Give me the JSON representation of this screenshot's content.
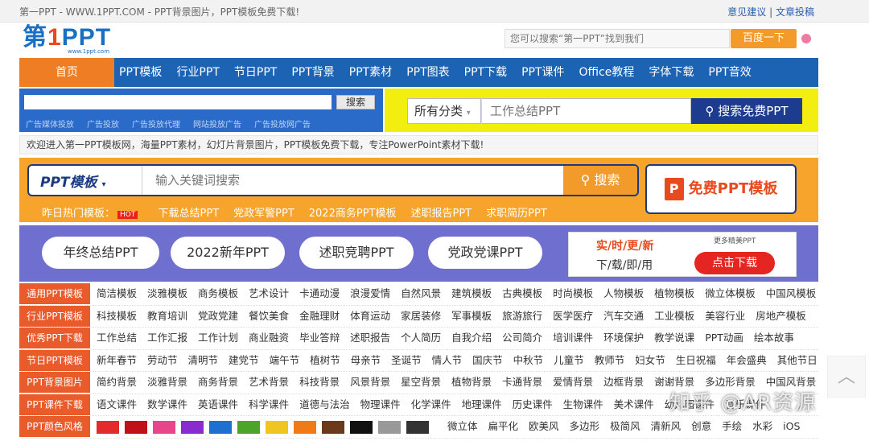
{
  "topbar": {
    "site": "第一PPT - WWW.1PPT.COM - PPT背景图片，PPT模板免费下载!",
    "feedback": "意见建议",
    "sep": " | ",
    "submit": "文章投稿"
  },
  "logo": {
    "text1": "第",
    "text2": "1",
    "text3": "PPT",
    "url": "www.1ppt.com"
  },
  "header_search": {
    "placeholder": "您可以搜索“第一PPT”找到我们",
    "button": "百度一下"
  },
  "nav": {
    "home": "首页",
    "items": [
      "PPT模板",
      "行业PPT",
      "节日PPT",
      "PPT背景",
      "PPT素材",
      "PPT图表",
      "PPT下载",
      "PPT课件",
      "Office教程",
      "字体下载",
      "PPT音效"
    ]
  },
  "ad": {
    "search_button": "搜索",
    "links": [
      "广告媒体投放",
      "广告投放",
      "广告投放代理",
      "网站投放广告",
      "广告投放网广告"
    ],
    "category": "所有分类",
    "keyword_placeholder": "工作总结PPT",
    "free_search": "搜索免费PPT"
  },
  "welcome": "欢迎进入第一PPT模板网，海量PPT素材，幻灯片背景图片，PPT模板免费下载，专注PowerPoint素材下载!",
  "orange": {
    "category": "PPT模板",
    "placeholder": "输入关键词搜索",
    "search": "搜索",
    "free": "免费PPT模板",
    "hot_label": "昨日热门模板：",
    "hot_badge": "HOT",
    "hot_items": [
      "下载总结PPT",
      "党政军警PPT",
      "2022商务PPT模板",
      "述职报告PPT",
      "求职简历PPT"
    ]
  },
  "purple": {
    "pills": [
      "年终总结PPT",
      "2022新年PPT",
      "述职竞聘PPT",
      "党政党课PPT"
    ],
    "banner_l1": "实/时/更/新",
    "banner_l2": "下/载/即/用",
    "banner_more": "更多精美PPT",
    "banner_btn": "点击下载"
  },
  "rows": [
    {
      "label": "通用PPT模板",
      "items": [
        "简洁模板",
        "淡雅模板",
        "商务模板",
        "艺术设计",
        "卡通动漫",
        "浪漫爱情",
        "自然风景",
        "建筑模板",
        "古典模板",
        "时尚模板",
        "人物模板",
        "植物模板",
        "微立体模板",
        "中国风模板"
      ]
    },
    {
      "label": "行业PPT模板",
      "items": [
        "科技模板",
        "教育培训",
        "党政党建",
        "餐饮美食",
        "金融理财",
        "体育运动",
        "家居装修",
        "军事模板",
        "旅游旅行",
        "医学医疗",
        "汽车交通",
        "工业模板",
        "美容行业",
        "房地产模板"
      ]
    },
    {
      "label": "优秀PPT下载",
      "items": [
        "工作总结",
        "工作汇报",
        "工作计划",
        "商业融资",
        "毕业答辩",
        "述职报告",
        "个人简历",
        "自我介绍",
        "公司简介",
        "培训课件",
        "环境保护",
        "教学说课",
        "PPT动画",
        "绘本故事"
      ]
    },
    {
      "label": "节日PPT模板",
      "items": [
        "新年春节",
        "劳动节",
        "清明节",
        "建党节",
        "端午节",
        "植树节",
        "母亲节",
        "圣诞节",
        "情人节",
        "国庆节",
        "中秋节",
        "儿童节",
        "教师节",
        "妇女节",
        "生日祝福",
        "年会盛典",
        "其他节日"
      ]
    },
    {
      "label": "PPT背景图片",
      "items": [
        "简约背景",
        "淡雅背景",
        "商务背景",
        "艺术背景",
        "科技背景",
        "风景背景",
        "星空背景",
        "植物背景",
        "卡通背景",
        "爱情背景",
        "边框背景",
        "谢谢背景",
        "多边形背景",
        "中国风背景"
      ]
    },
    {
      "label": "PPT课件下载",
      "items": [
        "语文课件",
        "数学课件",
        "英语课件",
        "科学课件",
        "道德与法治",
        "物理课件",
        "化学课件",
        "地理课件",
        "历史课件",
        "生物课件",
        "美术课件",
        "幼儿园课件",
        "音乐课件"
      ]
    }
  ],
  "color_row": {
    "label": "PPT颜色风格",
    "colors": [
      "#e32b2b",
      "#c0101a",
      "#e8458a",
      "#8a2bd0",
      "#1e6fd0",
      "#4aa52a",
      "#f0c520",
      "#f07a16",
      "#6b3a1a",
      "#111111",
      "#999999",
      "#333333"
    ],
    "styles": [
      "微立体",
      "扁平化",
      "欧美风",
      "多边形",
      "极简风",
      "清新风",
      "创意",
      "手绘",
      "水彩",
      "iOS"
    ]
  },
  "watermark": "知乎 @AR资源"
}
